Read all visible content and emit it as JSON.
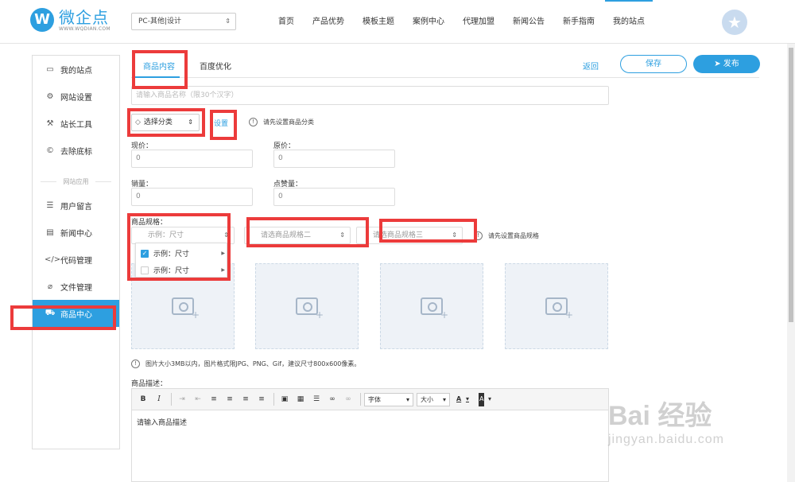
{
  "brand": {
    "badge": "W",
    "name": "微企点",
    "url": "WWW.WQDIAN.COM"
  },
  "site_select": {
    "value": "PC-其他|设计"
  },
  "nav": [
    "首页",
    "产品优势",
    "模板主题",
    "案例中心",
    "代理加盟",
    "新闻公告",
    "新手指南",
    "我的站点"
  ],
  "sidebar": {
    "items": [
      {
        "label": "我的站点",
        "icon": "monitor-icon",
        "glyph": "▭"
      },
      {
        "label": "网站设置",
        "icon": "gear-icon",
        "glyph": "⚙"
      },
      {
        "label": "站长工具",
        "icon": "wrench-icon",
        "glyph": "⚒"
      },
      {
        "label": "去除底标",
        "icon": "copyright-icon",
        "glyph": "©"
      },
      {
        "label": "用户留言",
        "icon": "message-icon",
        "glyph": "☰"
      },
      {
        "label": "新闻中心",
        "icon": "news-icon",
        "glyph": "▤"
      },
      {
        "label": "代码管理",
        "icon": "code-icon",
        "glyph": "</>"
      },
      {
        "label": "文件管理",
        "icon": "paperclip-icon",
        "glyph": "⌀"
      },
      {
        "label": "商品中心",
        "icon": "cart-icon",
        "glyph": "⛟"
      }
    ],
    "divider": "网站应用"
  },
  "tabs": {
    "content": "商品内容",
    "seo": "百度优化"
  },
  "actions": {
    "back": "返回",
    "save": "保存",
    "publish": "发布"
  },
  "form": {
    "name_placeholder": "请输入商品名称（限30个汉字）",
    "category": "选择分类",
    "set_link": "设置",
    "category_hint": "请先设置商品分类",
    "price_label": "现价：",
    "price_value": "0",
    "orig_price_label": "原价：",
    "orig_price_value": "0",
    "sales_label": "销量：",
    "sales_value": "0",
    "likes_label": "点赞量：",
    "likes_value": "0",
    "spec_label": "商品规格：",
    "spec1_placeholder": "示例：尺寸",
    "spec2_placeholder": "请选商品规格二",
    "spec3_placeholder": "请选商品规格三",
    "spec_hint": "请先设置商品规格",
    "spec_options": [
      {
        "label": "示例：尺寸",
        "checked": true
      },
      {
        "label": "示例：尺寸",
        "checked": false
      }
    ],
    "image_hint": "图片大小3MB以内，图片格式限JPG、PNG、Gif，建议尺寸800x600像素。",
    "desc_label": "商品描述：",
    "desc_placeholder": "请输入商品描述"
  },
  "editor": {
    "buttons": [
      {
        "name": "bold-icon",
        "glyph": "B"
      },
      {
        "name": "italic-icon",
        "glyph": "I"
      },
      {
        "name": "indent-icon",
        "glyph": "⇥"
      },
      {
        "name": "outdent-icon",
        "glyph": "⇤"
      },
      {
        "name": "align-left-icon",
        "glyph": "≡"
      },
      {
        "name": "align-center-icon",
        "glyph": "≡"
      },
      {
        "name": "align-right-icon",
        "glyph": "≡"
      },
      {
        "name": "align-justify-icon",
        "glyph": "≡"
      },
      {
        "name": "image-icon",
        "glyph": "▣"
      },
      {
        "name": "table-icon",
        "glyph": "▦"
      },
      {
        "name": "horizontal-rule-icon",
        "glyph": "☰"
      },
      {
        "name": "link-icon",
        "glyph": "∞"
      },
      {
        "name": "unlink-icon",
        "glyph": "∞"
      }
    ],
    "font_label": "字体",
    "size_label": "大小",
    "font_color_label": "A",
    "bg_color_label": "A"
  },
  "watermark": {
    "main": "Bai 经验",
    "sub": "jingyan.baidu.com"
  },
  "colors": {
    "accent": "#2d9fe0",
    "highlight_box": "#ec3b3b"
  }
}
